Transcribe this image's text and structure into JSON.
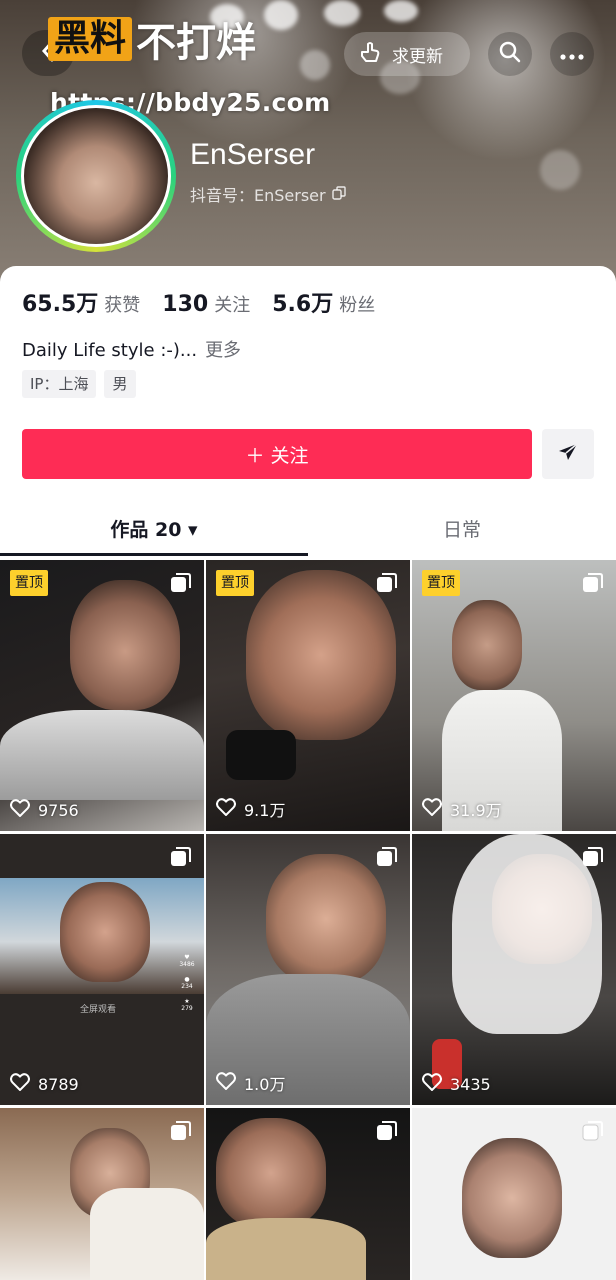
{
  "watermark": {
    "box_text": "黑料",
    "text": "不打烊",
    "url": "https://bbdy25.com"
  },
  "header": {
    "update_label": "求更新"
  },
  "profile": {
    "name": "EnSerser",
    "douyin_id": "抖音号：EnSerser"
  },
  "stats": [
    {
      "num": "65.5万",
      "label": "获赞"
    },
    {
      "num": "130",
      "label": "关注"
    },
    {
      "num": "5.6万",
      "label": "粉丝"
    }
  ],
  "bio": {
    "text": "Daily Life style :-)...",
    "more": "更多"
  },
  "tags": [
    "IP：上海",
    "男"
  ],
  "actions": {
    "follow": "＋ 关注"
  },
  "tabs": {
    "works": "作品 20 ▾",
    "daily": "日常"
  },
  "grid": [
    {
      "pinned": "置顶",
      "likes": "9756"
    },
    {
      "pinned": "置顶",
      "likes": "9.1万"
    },
    {
      "pinned": "置顶",
      "likes": "31.9万"
    },
    {
      "likes": "8789",
      "shot": {
        "fullscreen": "全屏观看",
        "likes": "3486",
        "comments": "234",
        "stars": "279"
      }
    },
    {
      "likes": "1.0万"
    },
    {
      "likes": "3435"
    },
    {
      "likes": ""
    },
    {
      "likes": ""
    },
    {
      "likes": ""
    }
  ],
  "colors": {
    "accent": "#fe2c55",
    "pin": "#fdd02c"
  }
}
